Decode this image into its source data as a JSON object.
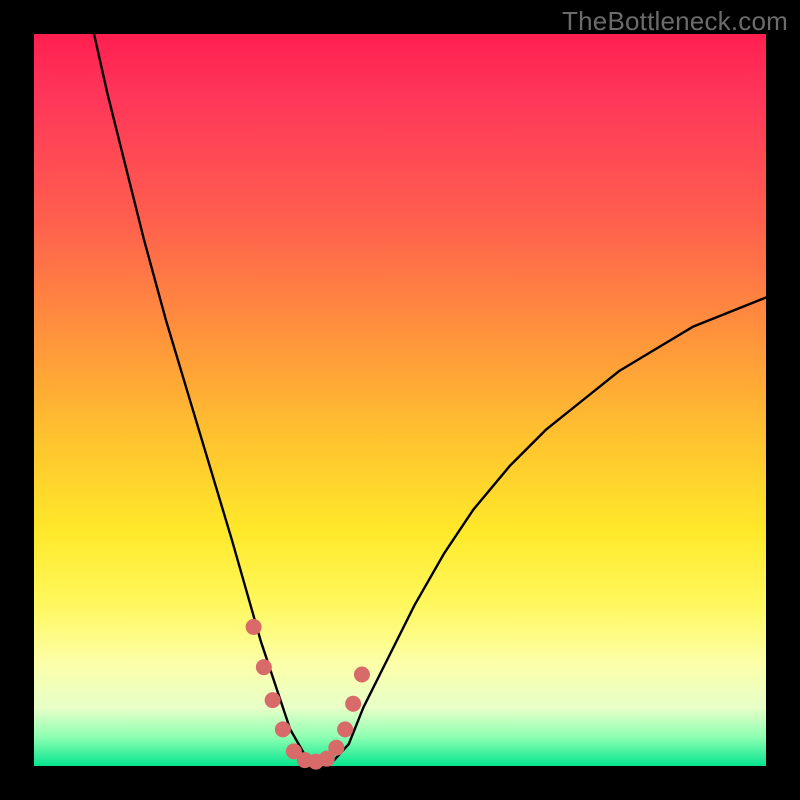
{
  "watermark": "TheBottleneck.com",
  "colors": {
    "page_bg": "#000000",
    "gradient_top": "#ff1f4f",
    "gradient_mid": "#ffe92a",
    "gradient_bottom": "#06e58f",
    "curve_stroke": "#000000",
    "marker_fill": "#d86a6a",
    "marker_stroke": "#c45b5b"
  },
  "chart_data": {
    "type": "line",
    "title": "",
    "xlabel": "",
    "ylabel": "",
    "xlim": [
      0,
      100
    ],
    "ylim": [
      0,
      100
    ],
    "grid": false,
    "legend": false,
    "note": "Axes have no tick labels in the source image; data is estimated from pixel positions. y is a percentage-like metric (0 = bottom green, 100 = top red); x is an unlabeled parameter. Curve is a V-shaped dip with flat-bottom minimum near x≈35–41 at y≈0, left arm reaching y=100 at x≈8, right arm rising asymptotically toward y≈65 at x=100.",
    "series": [
      {
        "name": "curve",
        "x": [
          8.2,
          10,
          12,
          15,
          18,
          21,
          24,
          27,
          29,
          31,
          33,
          35,
          37,
          39,
          41,
          43,
          45,
          48,
          52,
          56,
          60,
          65,
          70,
          75,
          80,
          85,
          90,
          95,
          100
        ],
        "y": [
          100,
          92,
          84,
          72,
          61,
          51,
          41,
          31,
          24,
          17,
          11,
          5,
          1.5,
          0.5,
          0.8,
          3,
          8,
          14,
          22,
          29,
          35,
          41,
          46,
          50,
          54,
          57,
          60,
          62,
          64
        ]
      }
    ],
    "markers": {
      "name": "highlight-dots",
      "x": [
        30.0,
        31.4,
        32.6,
        34.0,
        35.5,
        37.0,
        38.5,
        40.0,
        41.3,
        42.5,
        43.6,
        44.8
      ],
      "y": [
        19.0,
        13.5,
        9.0,
        5.0,
        2.0,
        0.8,
        0.6,
        1.0,
        2.5,
        5.0,
        8.5,
        12.5
      ]
    }
  }
}
